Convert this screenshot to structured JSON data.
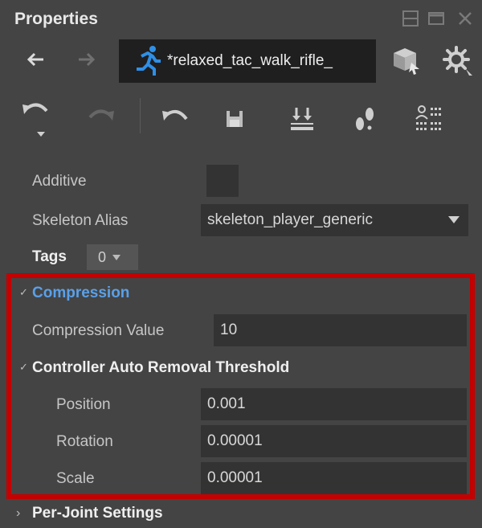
{
  "panel": {
    "title": "Properties",
    "asset_name": "*relaxed_tac_walk_rifle_",
    "icons": [
      "back-arrow-icon",
      "forward-arrow-icon",
      "running-figure-icon",
      "asset-box-icon",
      "settings-gear-icon",
      "undo-icon",
      "redo-icon",
      "revert-icon",
      "save-icon",
      "import-icon",
      "footsteps-icon",
      "list-grid-icon"
    ]
  },
  "properties": {
    "additive_label": "Additive",
    "skeleton_alias_label": "Skeleton Alias",
    "skeleton_alias_value": "skeleton_player_generic",
    "tags_label": "Tags",
    "tags_value": "0"
  },
  "compression": {
    "header": "Compression",
    "value_label": "Compression Value",
    "value": "10",
    "controller_header": "Controller Auto Removal Threshold",
    "position_label": "Position",
    "position_value": "0.001",
    "rotation_label": "Rotation",
    "rotation_value": "0.00001",
    "scale_label": "Scale",
    "scale_value": "0.00001"
  },
  "per_joint": {
    "header": "Per-Joint Settings"
  },
  "colors": {
    "highlight": "#c40000",
    "accent_blue": "#5aa0e8",
    "run_icon": "#2f8fe6"
  }
}
